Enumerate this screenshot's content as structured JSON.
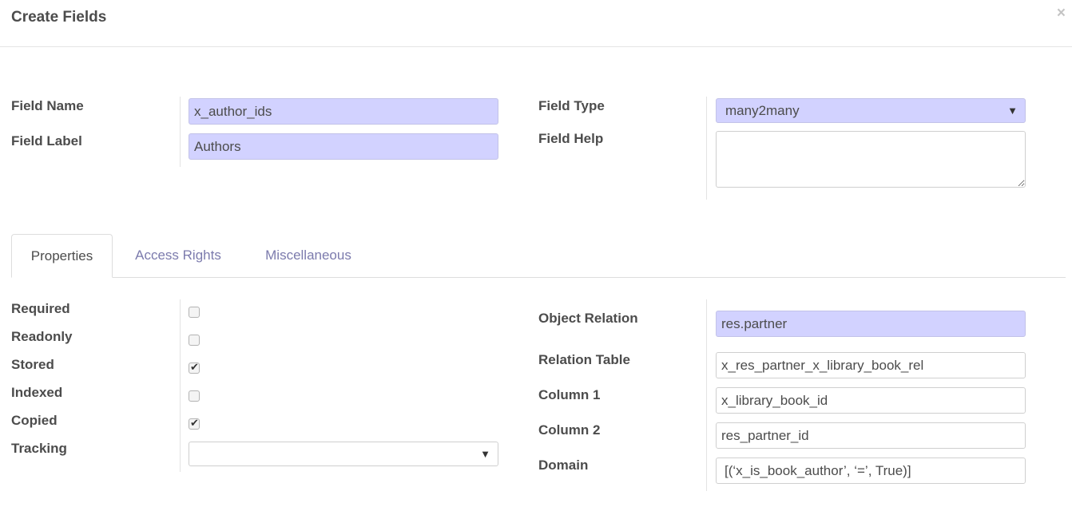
{
  "dialog": {
    "title": "Create Fields",
    "close": "×"
  },
  "top": {
    "field_name": {
      "label": "Field Name",
      "value": "x_author_ids"
    },
    "field_label": {
      "label": "Field Label",
      "value": "Authors"
    },
    "field_type": {
      "label": "Field Type",
      "value": "many2many"
    },
    "field_help": {
      "label": "Field Help",
      "value": ""
    }
  },
  "tabs": [
    {
      "label": "Properties",
      "active": true
    },
    {
      "label": "Access Rights",
      "active": false
    },
    {
      "label": "Miscellaneous",
      "active": false
    }
  ],
  "properties": {
    "required": {
      "label": "Required",
      "checked": false
    },
    "readonly": {
      "label": "Readonly",
      "checked": false
    },
    "stored": {
      "label": "Stored",
      "checked": true
    },
    "indexed": {
      "label": "Indexed",
      "checked": false
    },
    "copied": {
      "label": "Copied",
      "checked": true
    },
    "tracking": {
      "label": "Tracking",
      "value": ""
    }
  },
  "relation": {
    "object_relation": {
      "label": "Object Relation",
      "value": "res.partner"
    },
    "relation_table": {
      "label": "Relation Table",
      "value": "x_res_partner_x_library_book_rel"
    },
    "column1": {
      "label": "Column 1",
      "value": "x_library_book_id"
    },
    "column2": {
      "label": "Column 2",
      "value": "res_partner_id"
    },
    "domain": {
      "label": "Domain",
      "value": "[(‘x_is_book_author’, ‘=’, True)]"
    }
  },
  "colors": {
    "required_bg": "#d2d2ff",
    "tab_link": "#7c7bad",
    "text": "#4c4c4c"
  }
}
